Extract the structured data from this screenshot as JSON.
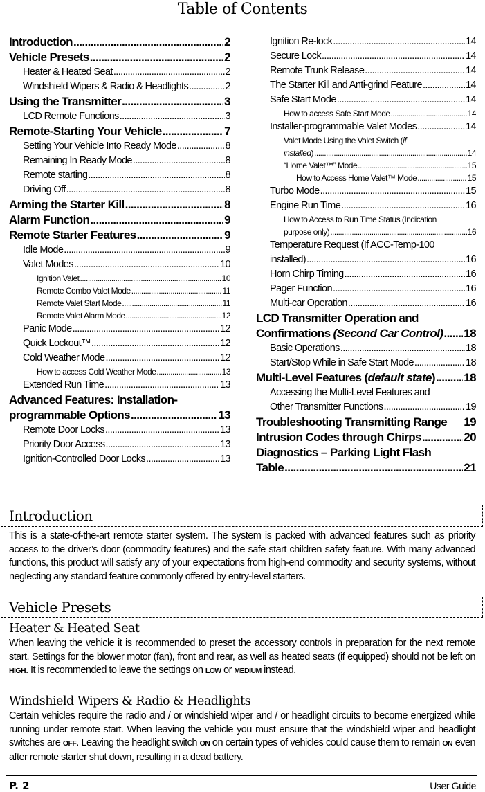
{
  "toc_title": "Table of Contents",
  "toc_left": [
    {
      "level": 1,
      "label": "Introduction",
      "page": "2"
    },
    {
      "level": 1,
      "label": "Vehicle Presets",
      "page": "2"
    },
    {
      "level": 2,
      "label": "Heater & Heated Seat",
      "page": "2"
    },
    {
      "level": 2,
      "label": "Windshield Wipers & Radio & Headlights",
      "page": "2"
    },
    {
      "level": 1,
      "label": "Using the Transmitter",
      "page": "3"
    },
    {
      "level": 2,
      "label": "LCD Remote Functions",
      "page": "3"
    },
    {
      "level": 1,
      "label": "Remote-Starting Your Vehicle",
      "page": "7"
    },
    {
      "level": 2,
      "label": "Setting Your Vehicle Into Ready Mode",
      "page": "8"
    },
    {
      "level": 2,
      "label": "Remaining In Ready Mode",
      "page": "8"
    },
    {
      "level": 2,
      "label": "Remote starting",
      "page": "8"
    },
    {
      "level": 2,
      "label": "Driving Off",
      "page": "8"
    },
    {
      "level": 1,
      "label": "Arming the Starter Kill",
      "page": "8"
    },
    {
      "level": 1,
      "label": "Alarm Function",
      "page": "9"
    },
    {
      "level": 1,
      "label": "Remote Starter Features",
      "page": "9"
    },
    {
      "level": 2,
      "label": "Idle Mode",
      "page": "9"
    },
    {
      "level": 2,
      "label": "Valet Modes",
      "page": "10"
    },
    {
      "level": 3,
      "label": "Ignition Valet",
      "page": "10"
    },
    {
      "level": 3,
      "label": "Remote Combo Valet Mode",
      "page": "11"
    },
    {
      "level": 3,
      "label": "Remote Valet Start Mode",
      "page": "11"
    },
    {
      "level": 3,
      "label": "Remote Valet Alarm Mode",
      "page": "12"
    },
    {
      "level": 2,
      "label": "Panic Mode",
      "page": "12"
    },
    {
      "level": 2,
      "label": "Quick Lockout™",
      "page": "12"
    },
    {
      "level": 2,
      "label": "Cold Weather Mode",
      "page": "12"
    },
    {
      "level": 3,
      "label": "How to access Cold Weather Mode",
      "page": "13"
    },
    {
      "level": 2,
      "label": "Extended Run Time",
      "page": "13"
    },
    {
      "level": 1,
      "label_line1": "Advanced Features: Installation-",
      "label": "programmable Options",
      "page": "13"
    },
    {
      "level": 2,
      "label": "Remote Door Locks",
      "page": "13"
    },
    {
      "level": 2,
      "label": "Priority Door Access",
      "page": "13"
    },
    {
      "level": 2,
      "label": "Ignition-Controlled Door Locks",
      "page": "13"
    }
  ],
  "toc_right": [
    {
      "level": 2,
      "label": "Ignition Re-lock",
      "page": "14"
    },
    {
      "level": 2,
      "label": "Secure Lock",
      "page": "14"
    },
    {
      "level": 2,
      "label": "Remote Trunk Release",
      "page": "14"
    },
    {
      "level": 2,
      "label": "The Starter Kill and Anti-grind Feature",
      "page": "14"
    },
    {
      "level": 2,
      "label": "Safe Start Mode",
      "page": "14"
    },
    {
      "level": 3,
      "label": "How to access Safe Start Mode",
      "page": "14"
    },
    {
      "level": 2,
      "label": "Installer-programmable Valet Modes",
      "page": "14"
    },
    {
      "level": 3,
      "label_line1": "Valet Mode Using the Valet Switch (if",
      "label": "installed)",
      "page": "14"
    },
    {
      "level": 3,
      "label": "“Home Valet™” Mode",
      "page": "15"
    },
    {
      "level": 4,
      "label": "How to Access Home Valet™ Mode",
      "page": "15"
    },
    {
      "level": 2,
      "label": "Turbo Mode",
      "page": "15"
    },
    {
      "level": 2,
      "label": "Engine Run Time",
      "page": "16"
    },
    {
      "level": 3,
      "label_line1": "How to Access to Run Time Status (Indication",
      "label": "purpose only)",
      "page": "16"
    },
    {
      "level": 2,
      "label_line1": "Temperature Request (If ACC-Temp-100",
      "label": "installed)",
      "page": "16"
    },
    {
      "level": 2,
      "label": "Horn Chirp Timing",
      "page": "16"
    },
    {
      "level": 2,
      "label": "Pager Function",
      "page": "16"
    },
    {
      "level": 2,
      "label": "Multi-car Operation",
      "page": "16"
    },
    {
      "level": 1,
      "label_line1": "LCD Transmitter Operation and",
      "label": "Confirmations (Second Car Control)",
      "page": "18"
    },
    {
      "level": 2,
      "label": "Basic Operations",
      "page": "18"
    },
    {
      "level": 2,
      "label": "Start/Stop While in Safe Start Mode",
      "page": "18"
    },
    {
      "level": 1,
      "label": "Multi-Level Features (default state)",
      "page": "18"
    },
    {
      "level": 2,
      "label_line1": "Accessing the Multi-Level Features and",
      "label": "Other Transmitter Functions",
      "page": "19"
    },
    {
      "level": 1,
      "label": "Troubleshooting Transmitting Range",
      "page": "19"
    },
    {
      "level": 1,
      "label": "Intrusion Codes through Chirps",
      "page": "20"
    },
    {
      "level": 1,
      "label_line1": "Diagnostics – Parking Light Flash",
      "label": "Table",
      "page": "21"
    }
  ],
  "intro": {
    "heading": "Introduction",
    "body": "This is a state-of-the-art remote starter system. The system is packed with advanced features such as priority access to the driver’s door (commodity features) and the safe start children safety feature.  With many advanced functions, this product will satisfy any of your expectations from high-end commodity and security systems, without neglecting any standard feature commonly offered by entry-level starters."
  },
  "presets": {
    "heading": "Vehicle Presets",
    "heater": {
      "heading": "Heater & Heated Seat",
      "body_1": "When leaving the vehicle it is recommended to preset the accessory controls in preparation for the next remote start. Settings for the blower motor (fan), front and rear, as well as heated seats (if equipped) should not be left on ",
      "high": "HIGH",
      "body_2": ". It is recommended to leave the settings on ",
      "low": "LOW",
      "or": " or ",
      "medium": "MEDIUM",
      "body_3": " instead."
    },
    "wipers": {
      "heading": "Windshield Wipers & Radio & Headlights",
      "body_1": "Certain vehicles require the radio and / or windshield wiper and / or headlight circuits to become energized while running under remote start. When leaving the vehicle you must ensure that the windshield wiper and headlight switches are ",
      "off": "OFF",
      "body_2": ". Leaving the headlight switch ",
      "on1": "ON",
      "body_3": " on certain types of vehicles could cause them to remain ",
      "on2": "ON",
      "body_4": " even after remote starter shut down, resulting in a dead battery."
    }
  },
  "footer": {
    "page": "P. 2",
    "guide": "User Guide"
  }
}
